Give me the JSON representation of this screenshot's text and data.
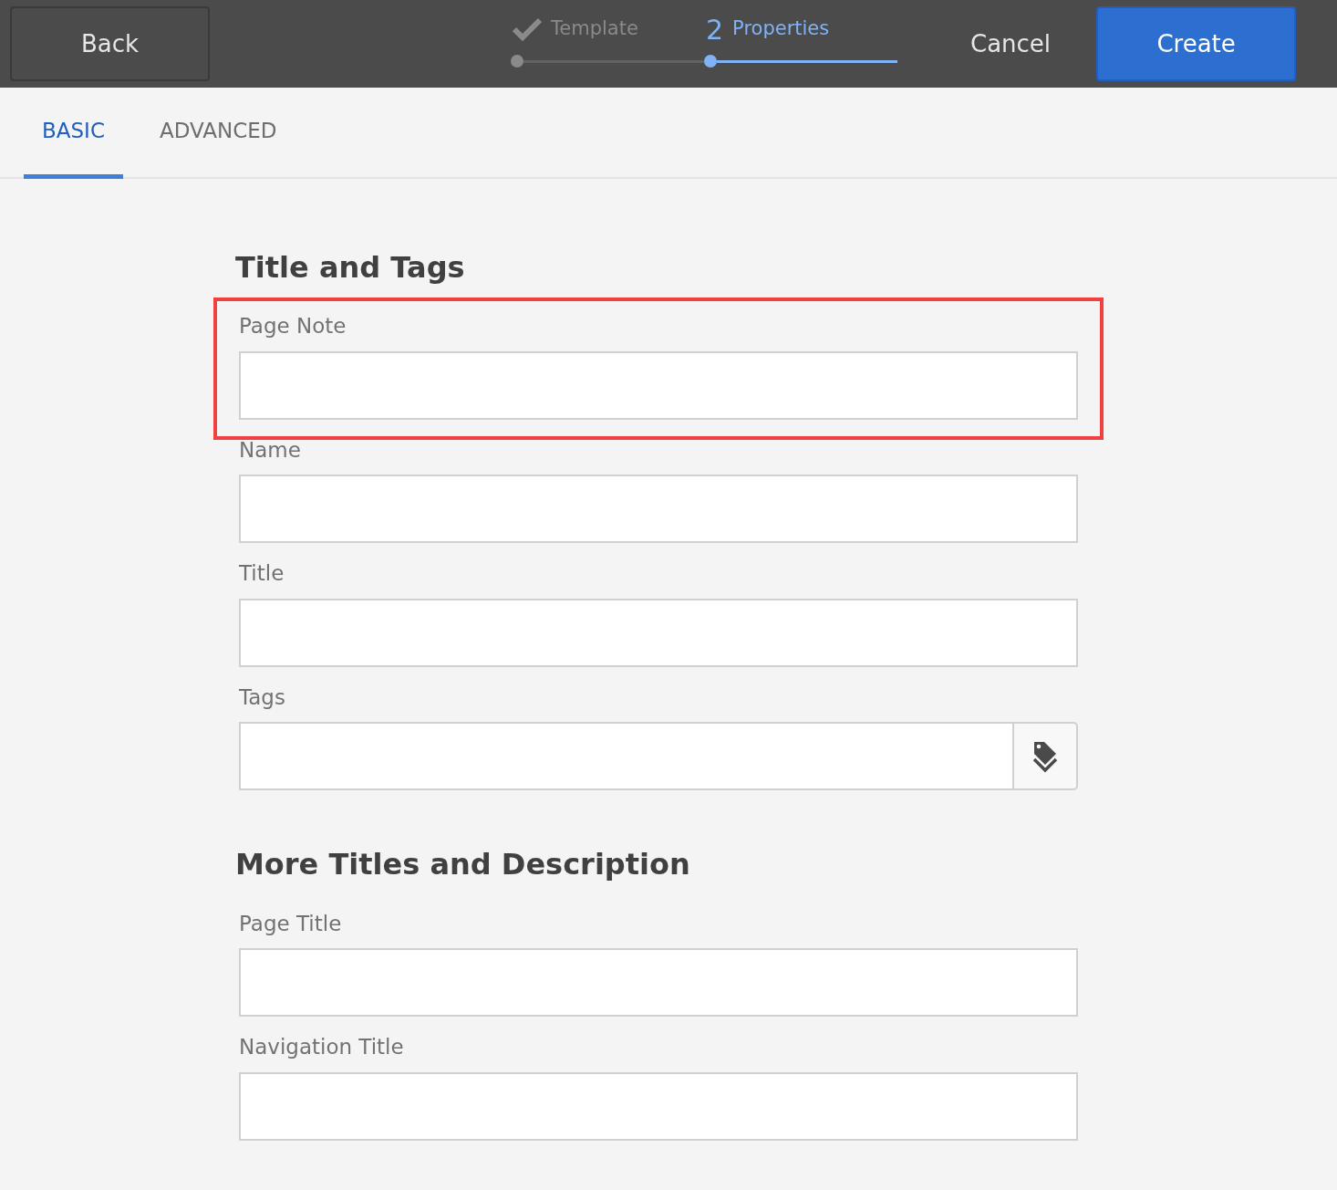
{
  "header": {
    "back": "Back",
    "cancel": "Cancel",
    "create": "Create",
    "steps": [
      {
        "label": "Template",
        "completed": true,
        "selected": false
      },
      {
        "label": "Properties",
        "number": "2",
        "completed": false,
        "selected": true
      }
    ]
  },
  "tabs": [
    {
      "label": "BASIC",
      "selected": true
    },
    {
      "label": "ADVANCED",
      "selected": false
    }
  ],
  "sections": [
    {
      "title": "Title and Tags",
      "fields": [
        {
          "label": "Page Note",
          "kind": "text",
          "highlighted": true
        },
        {
          "label": "Name",
          "kind": "text",
          "highlighted": false
        },
        {
          "label": "Title",
          "kind": "text",
          "highlighted": false
        },
        {
          "label": "Tags",
          "kind": "tags",
          "highlighted": false
        }
      ]
    },
    {
      "title": "More Titles and Description",
      "fields": [
        {
          "label": "Page Title",
          "kind": "text",
          "highlighted": false
        },
        {
          "label": "Navigation Title",
          "kind": "text",
          "highlighted": false
        }
      ]
    }
  ]
}
